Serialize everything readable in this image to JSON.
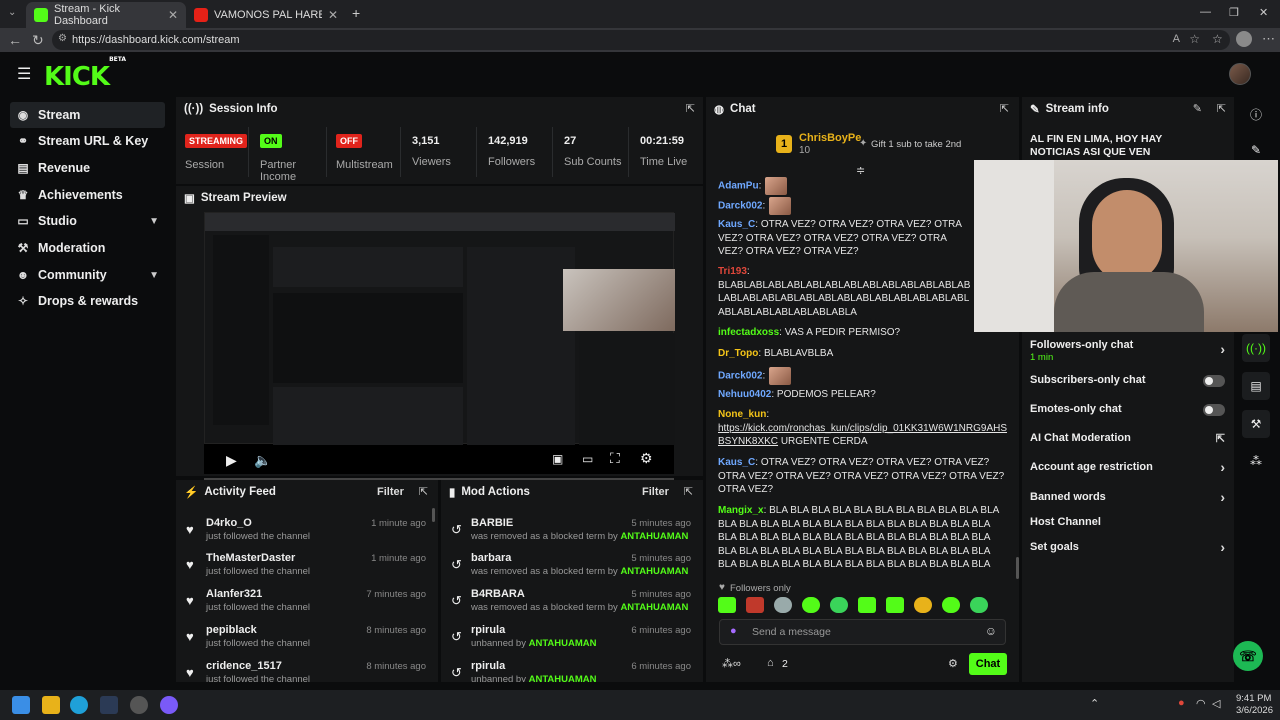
{
  "browser": {
    "tabs": [
      {
        "title": "Stream - Kick Dashboard",
        "active": true
      },
      {
        "title": "VAMONOS PAL HAREM REMIX - K",
        "active": false
      }
    ],
    "url": "https://dashboard.kick.com/stream"
  },
  "header": {
    "logo": "KICK",
    "logo_badge": "BETA"
  },
  "sidebar": {
    "items": [
      {
        "label": "Stream",
        "icon": "broadcast-icon",
        "active": true
      },
      {
        "label": "Stream URL & Key",
        "icon": "link-icon"
      },
      {
        "label": "Revenue",
        "icon": "revenue-icon"
      },
      {
        "label": "Achievements",
        "icon": "trophy-icon"
      },
      {
        "label": "Studio",
        "icon": "studio-icon",
        "expandable": true
      },
      {
        "label": "Moderation",
        "icon": "hammer-icon"
      },
      {
        "label": "Community",
        "icon": "people-icon",
        "expandable": true
      },
      {
        "label": "Drops & rewards",
        "icon": "gift-icon"
      }
    ]
  },
  "session_info": {
    "title": "Session Info",
    "streaming_badge": "STREAMING",
    "session_label": "Session",
    "partner_badge": "ON",
    "partner_label": "Partner Income",
    "multistream_badge": "OFF",
    "multistream_label": "Multistream",
    "viewers": "3,151",
    "viewers_label": "Viewers",
    "followers": "142,919",
    "followers_label": "Followers",
    "subs": "27",
    "subs_label": "Sub Counts",
    "time_live": "00:21:59",
    "time_live_label": "Time Live"
  },
  "stream_preview": {
    "title": "Stream Preview"
  },
  "activity_feed": {
    "title": "Activity Feed",
    "filter": "Filter",
    "items": [
      {
        "name": "D4rko_O",
        "action": "just followed the channel",
        "time": "1 minute ago"
      },
      {
        "name": "TheMasterDaster",
        "action": "just followed the channel",
        "time": "1 minute ago"
      },
      {
        "name": "Alanfer321",
        "action": "just followed the channel",
        "time": "7 minutes ago"
      },
      {
        "name": "pepiblack",
        "action": "just followed the channel",
        "time": "8 minutes ago"
      },
      {
        "name": "cridence_1517",
        "action": "just followed the channel",
        "time": "8 minutes ago"
      }
    ]
  },
  "mod_actions": {
    "title": "Mod Actions",
    "filter": "Filter",
    "items": [
      {
        "term": "BARBIE",
        "action": "was removed as a blocked term by",
        "mod": "ANTAHUAMAN",
        "time": "5 minutes ago"
      },
      {
        "term": "barbara",
        "action": "was removed as a blocked term by",
        "mod": "ANTAHUAMAN",
        "time": "5 minutes ago"
      },
      {
        "term": "B4RBARA",
        "action": "was removed as a blocked term by",
        "mod": "ANTAHUAMAN",
        "time": "5 minutes ago"
      },
      {
        "term": "rpirula",
        "action": "unbanned by",
        "mod": "ANTAHUAMAN",
        "time": "6 minutes ago"
      },
      {
        "term": "rpirula",
        "action": "unbanned by",
        "mod": "ANTAHUAMAN",
        "time": "6 minutes ago"
      }
    ]
  },
  "chat": {
    "title": "Chat",
    "top_gifter": {
      "rank": "1",
      "name": "ChrisBoyPe",
      "count": "10",
      "gift_text": "Gift 1 sub to take 2nd"
    },
    "messages": [
      {
        "user": "AdamPu",
        "color": "#6fa8ff",
        "text": ""
      },
      {
        "user": "Darck002",
        "color": "#6fa8ff",
        "text": ""
      },
      {
        "user": "Kaus_C",
        "color": "#6fa8ff",
        "text": "OTRA VEZ? OTRA VEZ? OTRA VEZ? OTRA VEZ? OTRA VEZ? OTRA VEZ? OTRA VEZ? OTRA VEZ? OTRA VEZ? OTRA VEZ?"
      },
      {
        "user": "Tri193",
        "color": "#e0473a",
        "text": "BLABLABLABLABLABLABLABLABLABLABLABLABLABLABLABLABLABLABLABLABLABLABLABLABLABLABLABLABLABLABLABLABLABLA"
      },
      {
        "user": "infectadxoss",
        "color": "#53fc18",
        "text": "VAS A PEDIR PERMISO?"
      },
      {
        "user": "Dr_Topo",
        "color": "#f5c518",
        "text": "BLABLAVBLBA"
      },
      {
        "user": "Darck002",
        "color": "#6fa8ff",
        "text": ""
      },
      {
        "user": "Nehuu0402",
        "color": "#6fa8ff",
        "text": "PODEMOS PELEAR?"
      },
      {
        "user": "None_kun",
        "color": "#f5c518",
        "text": "URGENTE CERDA",
        "link": "https://kick.com/ronchas_kun/clips/clip_01KK31W6W1NRG9AHSBSYNK8XKC"
      },
      {
        "user": "Kaus_C",
        "color": "#6fa8ff",
        "text": "OTRA VEZ? OTRA VEZ? OTRA VEZ? OTRA VEZ? OTRA VEZ? OTRA VEZ? OTRA VEZ? OTRA VEZ? OTRA VEZ? OTRA VEZ?"
      },
      {
        "user": "Mangix_x",
        "color": "#53fc18",
        "text": "BLA BLA BLA BLA BLA BLA BLA BLA BLA BLA BLA BLA BLA BLA BLA BLA BLA BLA BLA BLA BLA BLA BLA BLA BLA BLA BLA BLA BLA BLA BLA BLA BLA BLA BLA BLA BLA BLA BLA BLA BLA BLA BLA BLA BLA BLA BLA BLA BLA BLA BLA BLA BLA BLA BLA BLA BLA BLA BLA BLA BLA BLA BLA BLA BLA BLA BLA BLA BLA BLA"
      }
    ],
    "followers_only": "Followers only",
    "input_placeholder": "Send a message",
    "viewer_count": "2",
    "chat_button": "Chat"
  },
  "stream_info": {
    "title": "Stream info",
    "stream_title": "AL FIN EN LIMA, HOY HAY NOTICIAS ASI QUE VEN",
    "settings": [
      {
        "label": "Followers-only chat",
        "sub": "1 min",
        "control": "chevron"
      },
      {
        "label": "Subscribers-only chat",
        "control": "toggle"
      },
      {
        "label": "Emotes-only chat",
        "control": "toggle"
      },
      {
        "label": "AI Chat Moderation",
        "control": "external"
      },
      {
        "label": "Account age restriction",
        "control": "chevron"
      },
      {
        "label": "Banned words",
        "control": "chevron"
      },
      {
        "label": "Host Channel",
        "control": "none"
      },
      {
        "label": "Set goals",
        "control": "chevron"
      }
    ]
  },
  "taskbar": {
    "time": "9:41 PM",
    "date": "3/6/2026"
  },
  "colors": {
    "accent": "#53fc18",
    "streaming": "#e0241c",
    "panel": "#151617",
    "bg": "#0b0c0d"
  }
}
